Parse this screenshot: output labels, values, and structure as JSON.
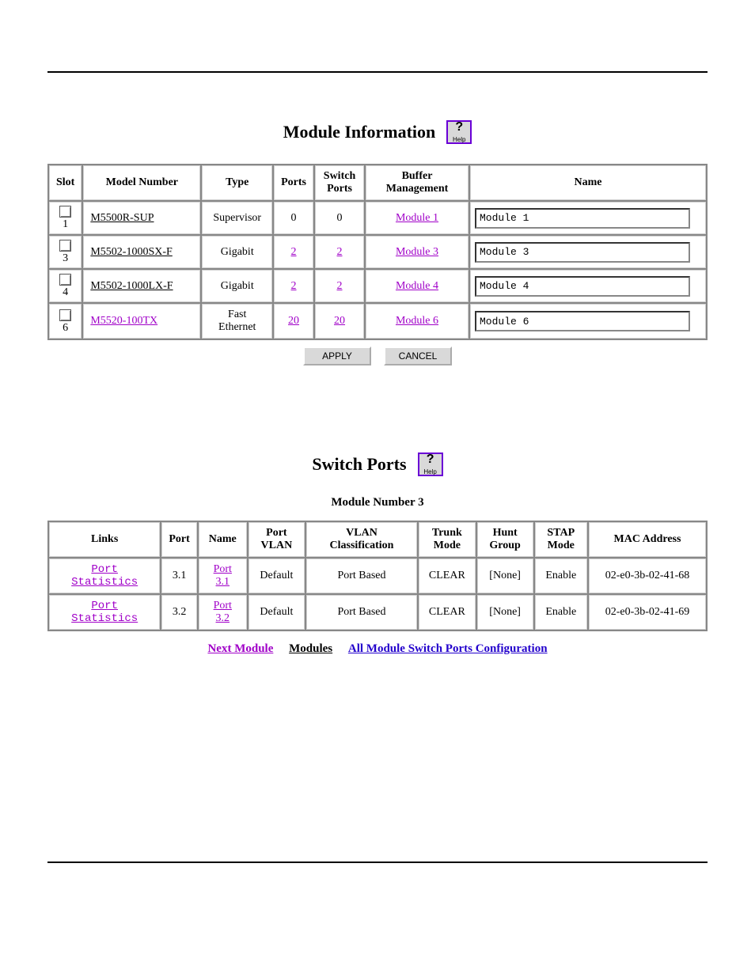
{
  "section1": {
    "title": "Module Information",
    "help_label": "Help",
    "headers": [
      "Slot",
      "Model Number",
      "Type",
      "Ports",
      "Switch Ports",
      "Buffer Management",
      "Name"
    ],
    "rows": [
      {
        "slot": "1",
        "model": "M5500R-SUP",
        "model_link": false,
        "type": "Supervisor",
        "ports": "0",
        "ports_link": false,
        "switch_ports": "0",
        "sp_link": false,
        "buffer": "Module 1",
        "name": "Module 1"
      },
      {
        "slot": "3",
        "model": "M5502-1000SX-F",
        "model_link": false,
        "type": "Gigabit",
        "ports": "2",
        "ports_link": true,
        "switch_ports": "2",
        "sp_link": true,
        "buffer": "Module 3",
        "name": "Module 3"
      },
      {
        "slot": "4",
        "model": "M5502-1000LX-F",
        "model_link": false,
        "type": "Gigabit",
        "ports": "2",
        "ports_link": true,
        "switch_ports": "2",
        "sp_link": true,
        "buffer": "Module 4",
        "name": "Module 4"
      },
      {
        "slot": "6",
        "model": "M5520-100TX",
        "model_link": true,
        "type": "Fast Ethernet",
        "ports": "20",
        "ports_link": true,
        "switch_ports": "20",
        "sp_link": true,
        "buffer": "Module 6",
        "name": "Module 6"
      }
    ],
    "buttons": {
      "apply": "APPLY",
      "cancel": "CANCEL"
    }
  },
  "section2": {
    "title": "Switch Ports",
    "help_label": "Help",
    "subtitle": "Module Number 3",
    "headers": [
      "Links",
      "Port",
      "Name",
      "Port VLAN",
      "VLAN Classification",
      "Trunk Mode",
      "Hunt Group",
      "STAP Mode",
      "MAC Address"
    ],
    "rows": [
      {
        "links": "Port Statistics",
        "port": "3.1",
        "name": "Port 3.1",
        "port_vlan": "Default",
        "vlan_class": "Port Based",
        "trunk": "CLEAR",
        "hunt": "[None]",
        "stap": "Enable",
        "mac": "02-e0-3b-02-41-68"
      },
      {
        "links": "Port Statistics",
        "port": "3.2",
        "name": "Port 3.2",
        "port_vlan": "Default",
        "vlan_class": "Port Based",
        "trunk": "CLEAR",
        "hunt": "[None]",
        "stap": "Enable",
        "mac": "02-e0-3b-02-41-69"
      }
    ],
    "nav": {
      "next_module": "Next Module",
      "modules": "Modules",
      "all_config": "All Module Switch Ports Configuration"
    }
  }
}
